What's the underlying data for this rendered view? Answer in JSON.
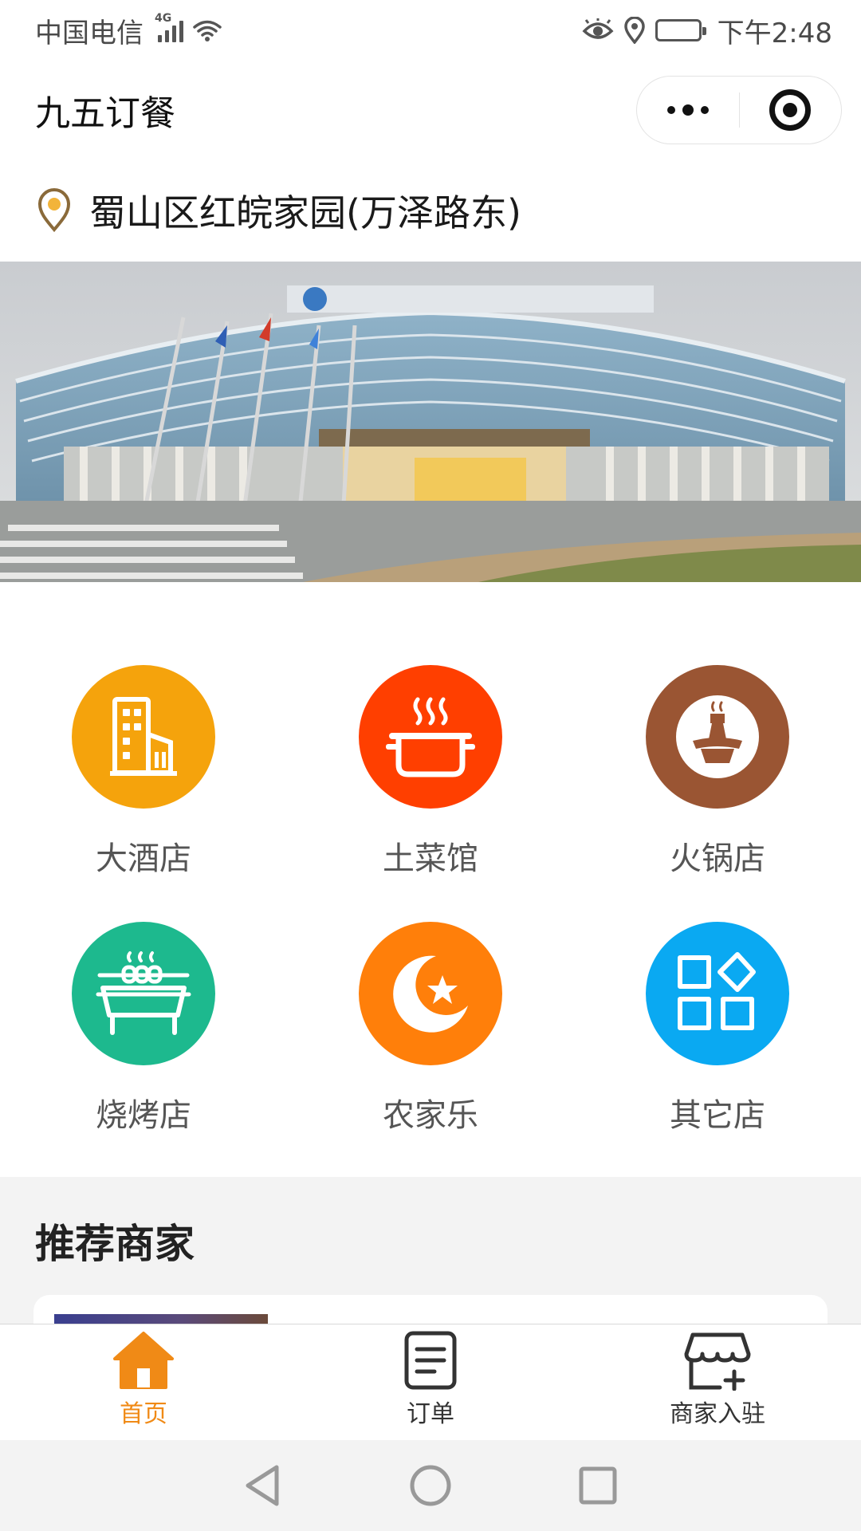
{
  "status_bar": {
    "carrier": "中国电信",
    "network": "4G",
    "time": "下午2:48"
  },
  "nav": {
    "title": "九五订餐"
  },
  "location": {
    "address": "蜀山区红皖家园(万泽路东)"
  },
  "categories": [
    {
      "label": "大酒店",
      "icon": "hotel-building-icon",
      "color": "#f5a30c"
    },
    {
      "label": "土菜馆",
      "icon": "cooking-pot-icon",
      "color": "#ff3f00"
    },
    {
      "label": "火锅店",
      "icon": "hotpot-icon",
      "color": "#9a5533"
    },
    {
      "label": "烧烤店",
      "icon": "bbq-grill-icon",
      "color": "#1db98e"
    },
    {
      "label": "农家乐",
      "icon": "crescent-star-icon",
      "color": "#ff7f0a"
    },
    {
      "label": "其它店",
      "icon": "apps-grid-icon",
      "color": "#0aa9f2"
    }
  ],
  "recommend": {
    "title": "推荐商家"
  },
  "tab_bar": {
    "items": [
      {
        "label": "首页",
        "icon": "home-icon",
        "active": true
      },
      {
        "label": "订单",
        "icon": "order-list-icon",
        "active": false
      },
      {
        "label": "商家入驻",
        "icon": "store-add-icon",
        "active": false
      }
    ]
  },
  "colors": {
    "accent": "#f08a16",
    "section_bg": "#f3f3f3"
  }
}
